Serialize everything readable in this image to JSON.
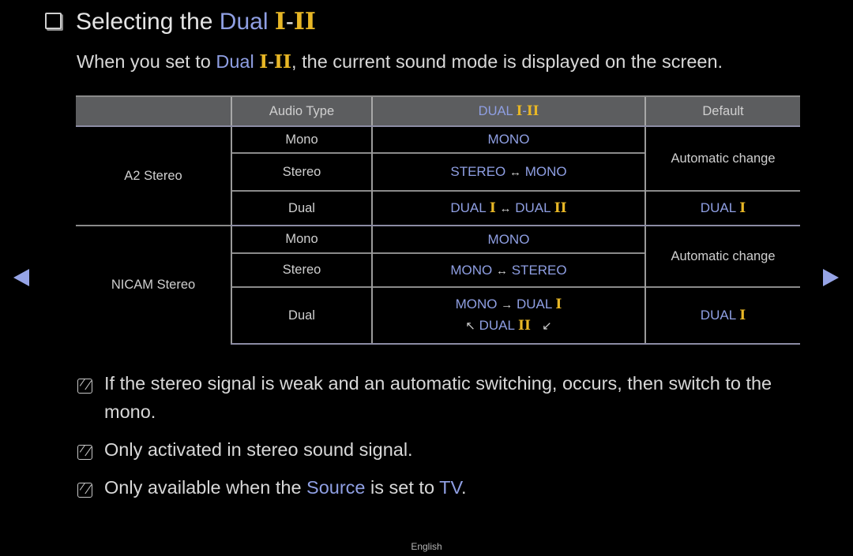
{
  "title": {
    "prefix": "Selecting the ",
    "highlight": "Dual",
    "numeral_1": "I",
    "sep": "-",
    "numeral_2": "II"
  },
  "intro": {
    "before": "When you set to ",
    "highlight": "Dual",
    "numeral_1": "I",
    "sep": "-",
    "numeral_2": "II",
    "after": ", the current sound mode is displayed on the screen."
  },
  "table": {
    "headers": {
      "col1": "",
      "col2": "Audio Type",
      "col3_label": "DUAL",
      "col3_num1": "I",
      "col3_sep": "-",
      "col3_num2": "II",
      "col4": "Default"
    },
    "groups": [
      {
        "name": "A2 Stereo",
        "rows": [
          {
            "audio_type": "Mono",
            "dual": {
              "a": "MONO"
            }
          },
          {
            "audio_type": "Stereo",
            "dual": {
              "a": "STEREO",
              "arrow": "↔",
              "b": "MONO"
            }
          },
          {
            "audio_type": "Dual",
            "dual": {
              "a": "DUAL",
              "a_num": "I",
              "arrow": "↔",
              "b": "DUAL",
              "b_num": "II"
            }
          }
        ],
        "default_auto": "Automatic change",
        "default_dual": {
          "label": "DUAL",
          "num": "I"
        }
      },
      {
        "name": "NICAM Stereo",
        "rows": [
          {
            "audio_type": "Mono",
            "dual": {
              "a": "MONO"
            }
          },
          {
            "audio_type": "Stereo",
            "dual": {
              "a": "MONO",
              "arrow": "↔",
              "b": "STEREO"
            }
          },
          {
            "audio_type": "Dual",
            "dual": {
              "a": "MONO",
              "arrow": "→",
              "b": "DUAL",
              "b_num": "I",
              "arrow2": "↖",
              "c": "DUAL",
              "c_num": "II",
              "arrow3": "↙"
            }
          }
        ],
        "default_auto": "Automatic change",
        "default_dual": {
          "label": "DUAL",
          "num": "I"
        }
      }
    ]
  },
  "notes": [
    {
      "text": "If the stereo signal is weak and an automatic switching, occurs, then switch to the mono."
    },
    {
      "text": "Only activated in stereo sound signal."
    },
    {
      "before": "Only available when the ",
      "source": "Source",
      "middle": " is set to ",
      "tv": "TV",
      "after": "."
    }
  ],
  "nav": {
    "prev": "previous-page",
    "next": "next-page"
  },
  "footer": {
    "language": "English"
  },
  "colors": {
    "accent_blue": "#8f9fe3",
    "numeral_gold": "#e8b726",
    "header_bg": "#5c5d5f",
    "background": "#000000"
  }
}
